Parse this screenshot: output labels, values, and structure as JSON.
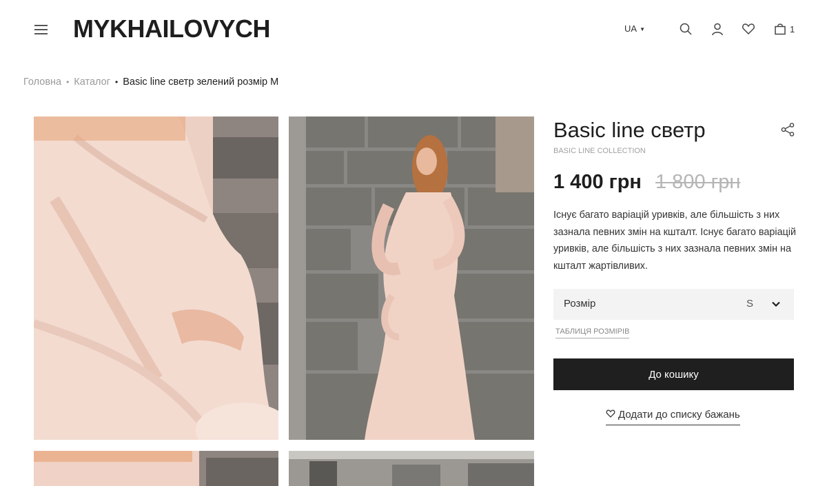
{
  "header": {
    "logo": "MYKHAILOVYCH",
    "language": "UA",
    "cart_count": "1",
    "icons": [
      "menu-icon",
      "search-icon",
      "user-icon",
      "heart-icon",
      "bag-icon"
    ]
  },
  "breadcrumb": {
    "items": [
      "Головна",
      "Каталог"
    ],
    "current": "Basic line светр зелений розмір M"
  },
  "product": {
    "title": "Basic line светр",
    "collection": "BASIC LINE COLLECTION",
    "price": "1 400 грн",
    "old_price": "1 800 грн",
    "description": "Існує багато варіацій уривків, але більшість з них зазнала певних змін на кшталт. Існує багато варіацій уривків, але більшість з них зазнала певних змін на кшталт жартівливих.",
    "size_label": "Розмір",
    "size_value": "S",
    "size_table_link": "ТАБЛИЦЯ РОЗМІРІВ",
    "add_to_cart": "До кошику",
    "wishlist": "Додати до списку бажань"
  },
  "colors": {
    "text": "#1e1e1e",
    "muted": "#9a9a9a",
    "button": "#1f1f1f",
    "select_bg": "#f3f3f3",
    "sweater": "#f1d3c6"
  }
}
